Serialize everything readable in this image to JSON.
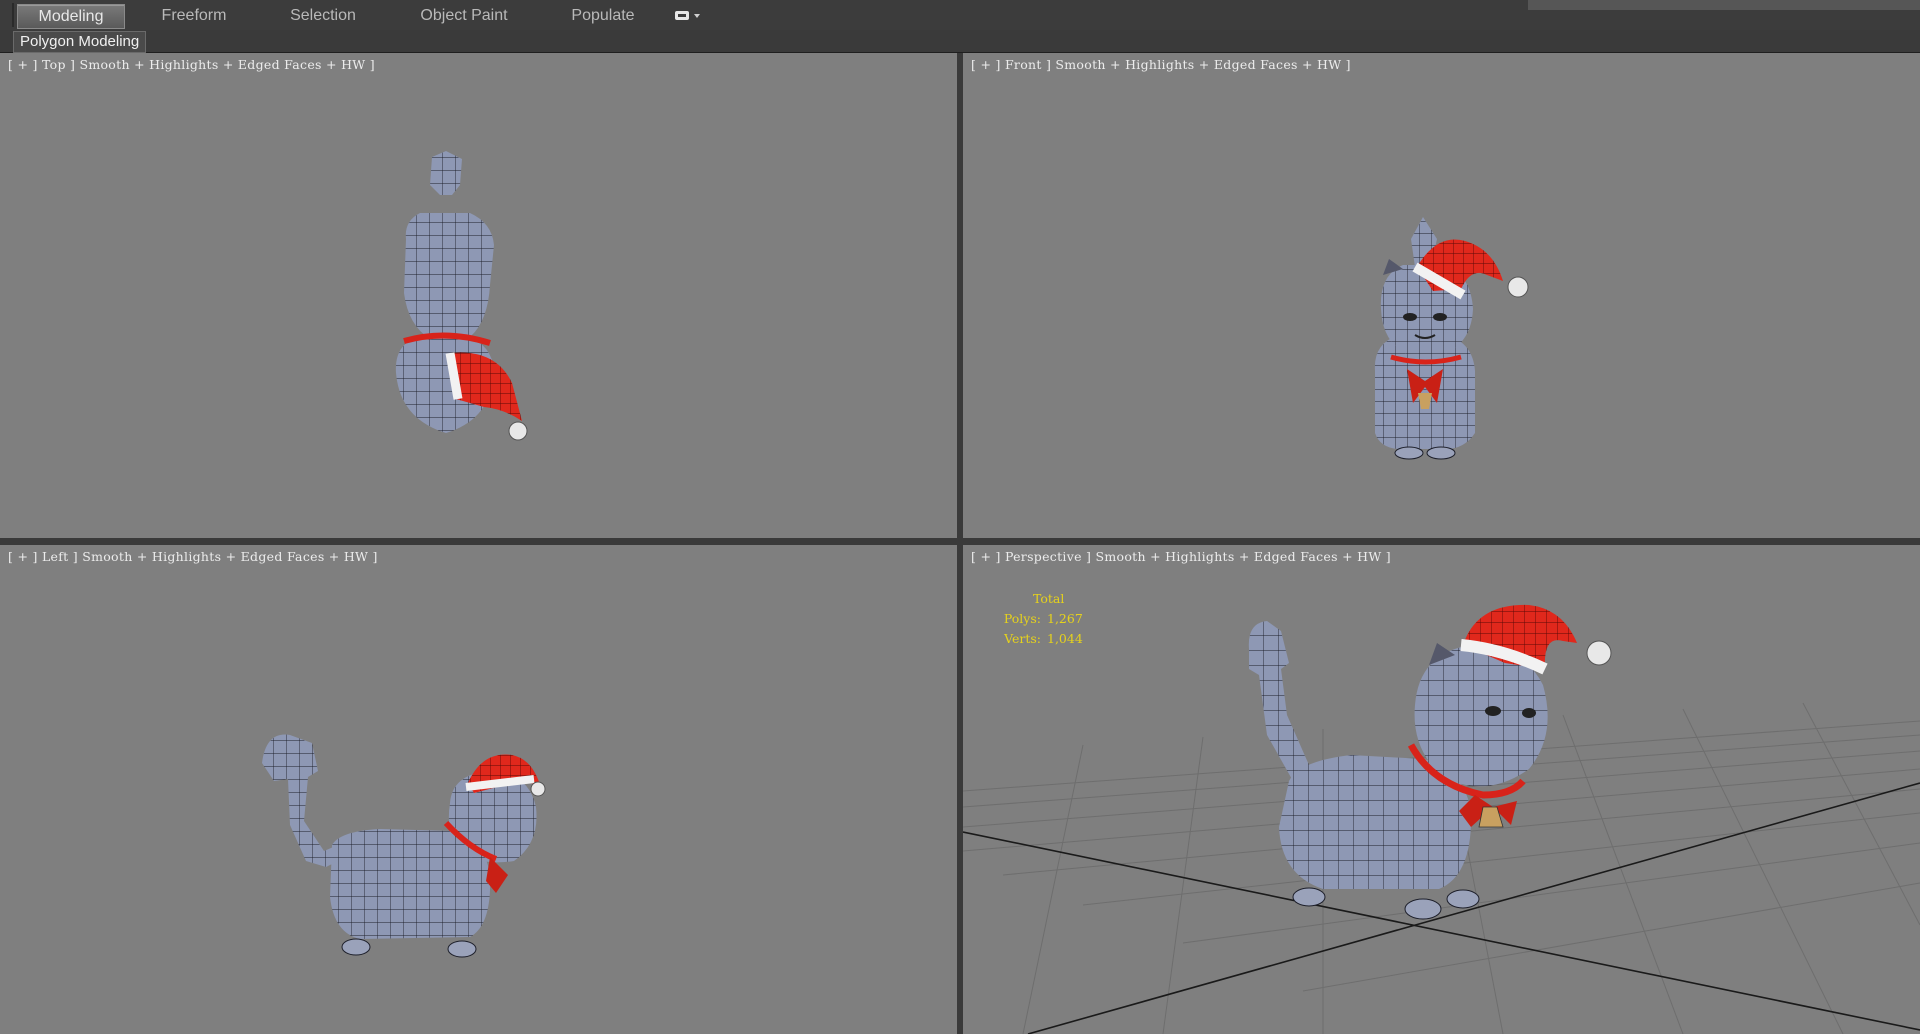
{
  "ribbon": {
    "tabs": [
      {
        "label": "Modeling",
        "active": true
      },
      {
        "label": "Freeform",
        "active": false
      },
      {
        "label": "Selection",
        "active": false
      },
      {
        "label": "Object Paint",
        "active": false
      },
      {
        "label": "Populate",
        "active": false
      }
    ],
    "dropdown_icon": "toggle-options-icon",
    "panel_label": "Polygon Modeling"
  },
  "viewports": {
    "top": {
      "label": "[ + ] Top ] Smooth + Highlights + Edged Faces + HW ]"
    },
    "front": {
      "label": "[ + ] Front ] Smooth + Highlights + Edged Faces + HW ]"
    },
    "left": {
      "label": "[ + ] Left ] Smooth + Highlights + Edged Faces + HW ]"
    },
    "perspective": {
      "label": "[ + ] Perspective ] Smooth + Highlights + Edged Faces + HW ]",
      "stats": {
        "total_label": "Total",
        "polys_label": "Polys:",
        "polys_value": "1,267",
        "verts_label": "Verts:",
        "verts_value": "1,044"
      }
    }
  },
  "colors": {
    "viewport_bg": "#7f7f7f",
    "stats_text": "#e6d21c",
    "model_body": "#8e98b4",
    "hat_red": "#e0281c",
    "hat_white": "#f2f2f2",
    "wire": "#1d1f2a"
  }
}
